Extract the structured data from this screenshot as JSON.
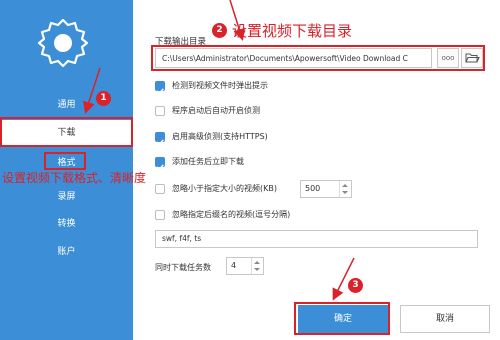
{
  "sidebar": {
    "items": [
      {
        "label": "通用"
      },
      {
        "label": "下载"
      },
      {
        "label": "格式"
      },
      {
        "label": "录屏"
      },
      {
        "label": "转换"
      },
      {
        "label": "账户"
      }
    ]
  },
  "settings": {
    "output_dir_label": "下载输出目录",
    "output_dir_value": "C:\\Users\\Administrator\\Documents\\Apowersoft\\Video Download C",
    "more_button": "ooo",
    "options": [
      {
        "label": "检测到视频文件时弹出提示",
        "checked": true
      },
      {
        "label": "程序启动后自动开启侦测",
        "checked": false
      },
      {
        "label": "启用高级侦测(支持HTTPS)",
        "checked": true
      },
      {
        "label": "添加任务后立即下载",
        "checked": true
      },
      {
        "label": "忽略小于指定大小的视频(KB)",
        "checked": false
      },
      {
        "label": "忽略指定后缀名的视频(逗号分隔)",
        "checked": false
      }
    ],
    "min_size_value": "500",
    "extensions_value": "swf, f4f, ts",
    "concurrent_label": "同时下载任务数",
    "concurrent_value": "4"
  },
  "buttons": {
    "ok": "确定",
    "cancel": "取消"
  },
  "annotations": {
    "step1": "1",
    "step2": "2",
    "step3": "3",
    "note_dir": "设置视频下载目录",
    "note_format": "设置视频下载格式、清晰度"
  },
  "colors": {
    "accent": "#3c8fd7",
    "annotation": "#d9222a"
  }
}
